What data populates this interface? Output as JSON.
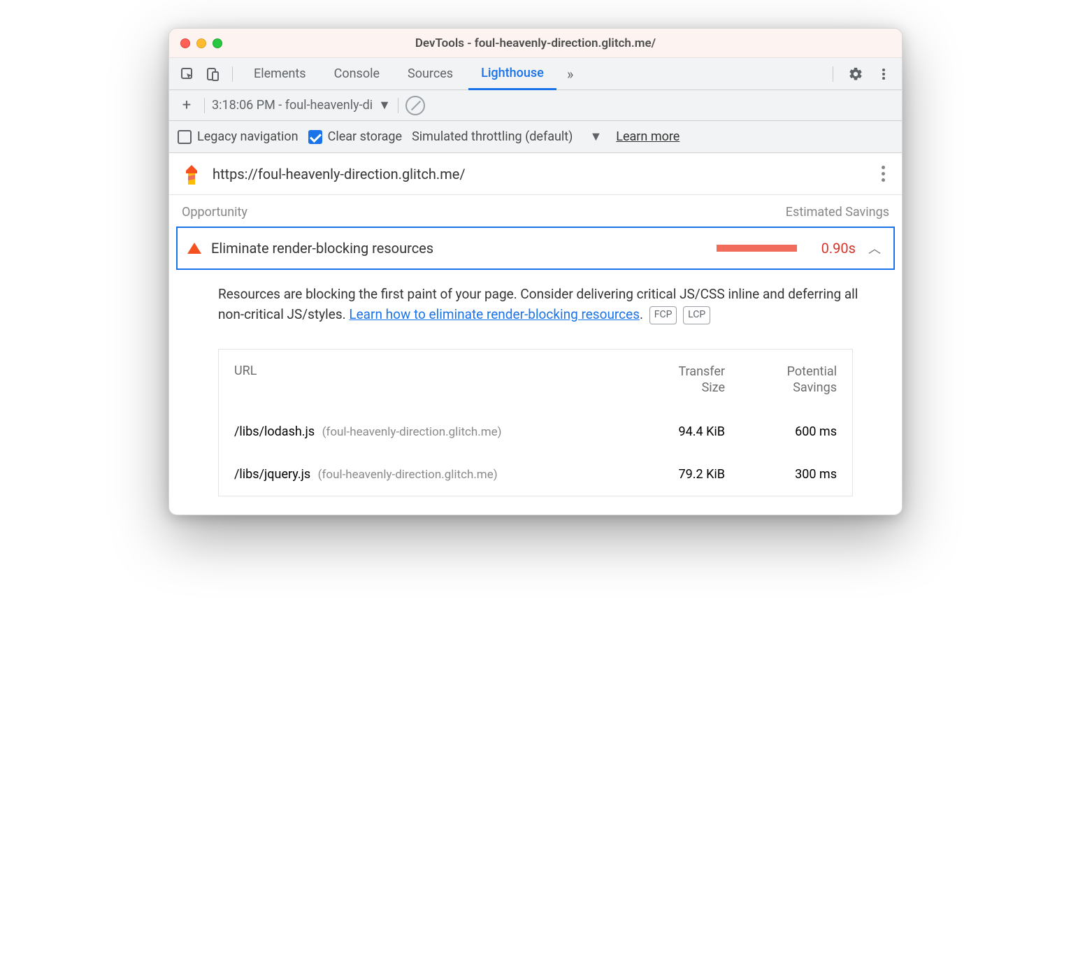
{
  "window": {
    "title": "DevTools - foul-heavenly-direction.glitch.me/"
  },
  "tabs": {
    "items": [
      "Elements",
      "Console",
      "Sources",
      "Lighthouse"
    ],
    "active": "Lighthouse"
  },
  "toolbar": {
    "report_label": "3:18:06 PM - foul-heavenly-di",
    "legacy_label": "Legacy navigation",
    "clear_label": "Clear storage",
    "throttling_label": "Simulated throttling (default)",
    "learn_more": "Learn more"
  },
  "report": {
    "url": "https://foul-heavenly-direction.glitch.me/"
  },
  "opportunity": {
    "header_left": "Opportunity",
    "header_right": "Estimated Savings",
    "title": "Eliminate render-blocking resources",
    "savings": "0.90s",
    "desc_pre": "Resources are blocking the first paint of your page. Consider delivering critical JS/CSS inline and deferring all non-critical JS/styles. ",
    "desc_link": "Learn how to eliminate render-blocking resources",
    "desc_post": ".",
    "tags": [
      "FCP",
      "LCP"
    ]
  },
  "table": {
    "headers": {
      "url": "URL",
      "transfer": "Transfer Size",
      "savings": "Potential Savings"
    },
    "rows": [
      {
        "path": "/libs/lodash.js",
        "host": "(foul-heavenly-direction.glitch.me)",
        "size": "94.4 KiB",
        "savings": "600 ms"
      },
      {
        "path": "/libs/jquery.js",
        "host": "(foul-heavenly-direction.glitch.me)",
        "size": "79.2 KiB",
        "savings": "300 ms"
      }
    ]
  }
}
